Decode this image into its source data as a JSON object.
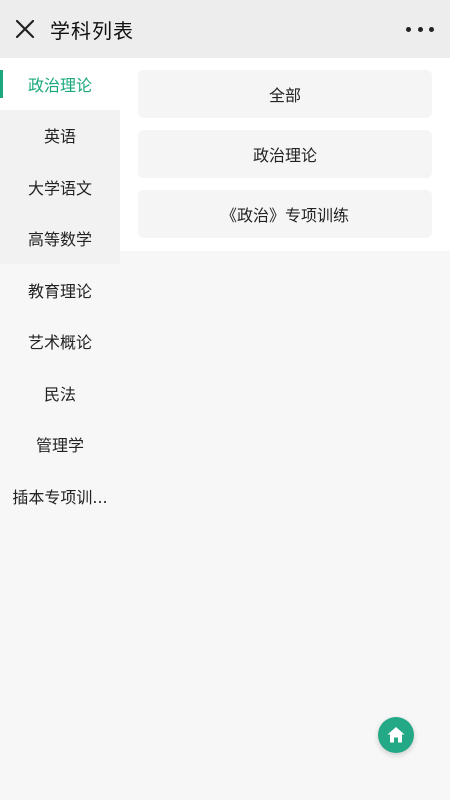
{
  "header": {
    "title": "学科列表",
    "close_icon": "close-icon",
    "more_icon": "more-dots-icon"
  },
  "sidebar": {
    "items": [
      {
        "label": "政治理论",
        "active": true
      },
      {
        "label": "英语"
      },
      {
        "label": "大学语文"
      },
      {
        "label": "高等数学"
      },
      {
        "label": "教育理论"
      },
      {
        "label": "艺术概论"
      },
      {
        "label": "民法"
      },
      {
        "label": "管理学"
      },
      {
        "label": "插本专项训..."
      }
    ]
  },
  "content": {
    "categories": [
      {
        "label": "全部"
      },
      {
        "label": "政治理论"
      },
      {
        "label": "《政治》专项训练"
      }
    ]
  },
  "fab": {
    "icon": "home-icon"
  },
  "colors": {
    "accent": "#1aa87c",
    "fab": "#23a985"
  }
}
